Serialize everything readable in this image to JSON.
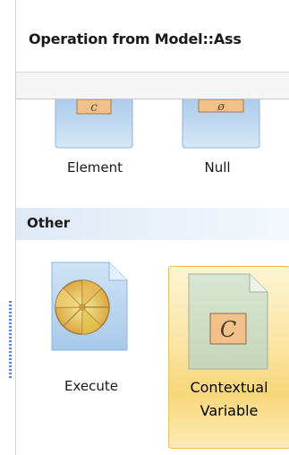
{
  "panel": {
    "title": "Operation from Model::Ass"
  },
  "palette": {
    "top_items": [
      {
        "label": "Element",
        "icon": "element-class-icon"
      },
      {
        "label": "Null",
        "icon": "null-icon"
      }
    ],
    "sections": [
      {
        "label": "Other",
        "items": [
          {
            "label": "Execute",
            "icon": "execute-wheel-icon",
            "selected": false
          },
          {
            "label_line1": "Contextual",
            "label_line2": "Variable",
            "icon": "contextual-variable-icon",
            "selected": true
          }
        ]
      }
    ]
  },
  "colors": {
    "selection": "#f8d77a",
    "section_header": "#dfe9f5",
    "grip": "#5b7fd0"
  }
}
